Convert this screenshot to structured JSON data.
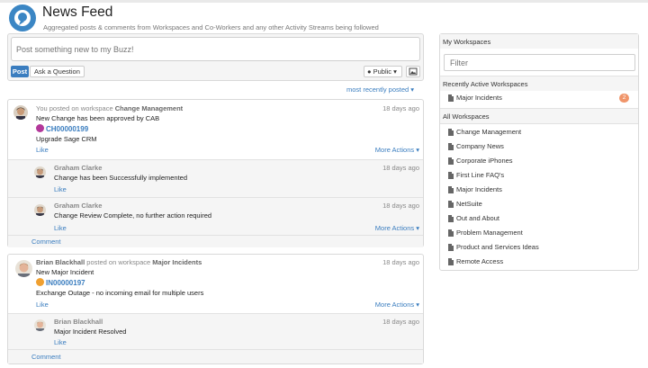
{
  "header": {
    "title": "News Feed",
    "subtitle": "Aggregated posts & comments from Workspaces and Co-Workers and any other Activity Streams being followed"
  },
  "composer": {
    "placeholder": "Post something new to my Buzz!",
    "post_label": "Post",
    "ask_label": "Ask a Question",
    "visibility_label": "Public",
    "visibility_icon": "globe-icon",
    "image_icon": "image-icon"
  },
  "sort_label": "most recently posted",
  "feed": [
    {
      "author": "You",
      "action": "posted on workspace",
      "workspace": "Change Management",
      "time": "18 days ago",
      "title": "New Change has been approved by CAB",
      "ref": "CH00000199",
      "ref_color": "#b3389a",
      "body": "Upgrade Sage CRM",
      "like": "Like",
      "more_actions": "More Actions",
      "comments": [
        {
          "author": "Graham Clarke",
          "time": "18 days ago",
          "text": "Change has been Successfully implemented",
          "like": "Like"
        },
        {
          "author": "Graham Clarke",
          "time": "18 days ago",
          "text": "Change Review Complete, no further action required",
          "like": "Like",
          "more_actions": "More Actions"
        }
      ],
      "comment_label": "Comment"
    },
    {
      "author": "Brian Blackhall",
      "action": "posted on workspace",
      "workspace": "Major Incidents",
      "time": "18 days ago",
      "title": "New Major Incident",
      "ref": "IN00000197",
      "ref_color": "#f0a030",
      "body": "Exchange Outage - no incoming email for multiple users",
      "like": "Like",
      "more_actions": "More Actions",
      "comments": [
        {
          "author": "Brian Blackhall",
          "time": "18 days ago",
          "text": "Major Incident Resolved",
          "like": "Like"
        }
      ],
      "comment_label": "Comment"
    }
  ],
  "sidebar": {
    "my_workspaces": "My Workspaces",
    "filter_placeholder": "Filter",
    "recent_heading": "Recently Active Workspaces",
    "recent": [
      {
        "label": "Major Incidents",
        "count": "2"
      }
    ],
    "all_heading": "All Workspaces",
    "all": [
      "Change Management",
      "Company News",
      "Corporate iPhones",
      "First Line FAQ's",
      "Major Incidents",
      "NetSuite",
      "Out and About",
      "Problem Management",
      "Product and Services Ideas",
      "Remote Access"
    ]
  },
  "colors": {
    "accent": "#3a7dbf",
    "badge": "#f0956a"
  }
}
